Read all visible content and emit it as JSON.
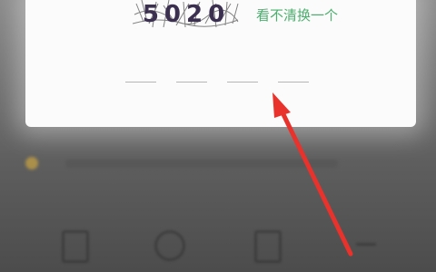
{
  "dialog": {
    "captcha_text": "5020",
    "refresh_link": "看不清换一个",
    "code_slots": 4
  },
  "annotation": {
    "arrow_color": "#e8322b"
  },
  "colors": {
    "link": "#4caf6e",
    "overlay": "#6f6f6f"
  }
}
